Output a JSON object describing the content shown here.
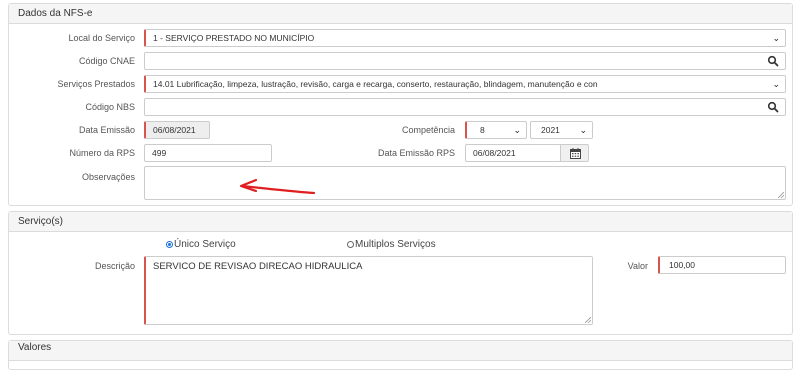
{
  "dados_panel": {
    "title": "Dados da NFS-e",
    "local_servico": {
      "label": "Local do Serviço",
      "value": "1 - SERVIÇO PRESTADO NO MUNICÍPIO"
    },
    "codigo_cnae": {
      "label": "Código CNAE",
      "value": ""
    },
    "servicos_prestados": {
      "label": "Serviços Prestados",
      "value": "14.01 Lubrificação, limpeza, lustração, revisão, carga e recarga, conserto, restauração, blindagem, manutenção e con"
    },
    "codigo_nbs": {
      "label": "Código NBS",
      "value": ""
    },
    "data_emissao": {
      "label": "Data Emissão",
      "value": "06/08/2021"
    },
    "competencia": {
      "label": "Competência",
      "month": "8",
      "year": "2021"
    },
    "numero_rps": {
      "label": "Número da RPS",
      "value": "499"
    },
    "data_emissao_rps": {
      "label": "Data Emissão RPS",
      "value": "06/08/2021"
    },
    "observacoes": {
      "label": "Observações",
      "value": ""
    }
  },
  "servicos_panel": {
    "title": "Serviço(s)",
    "radio_unico": "Único Serviço",
    "radio_multiplos": "Multiplos Serviços",
    "descricao": {
      "label": "Descrição",
      "value": "SERVICO DE REVISAO DIRECAO HIDRAULICA"
    },
    "valor": {
      "label": "Valor",
      "value": "100,00"
    }
  },
  "valores_panel": {
    "title": "Valores"
  },
  "icons": {
    "search": "search-icon",
    "caret": "chevron-down-icon",
    "calendar": "calendar-icon",
    "resize": "resize-grip-icon",
    "annotation": "red-arrow-annotation"
  },
  "colors": {
    "required_border": "#d9534f",
    "annotation_arrow": "#e02020",
    "radio_selected": "#1a6fd6"
  }
}
